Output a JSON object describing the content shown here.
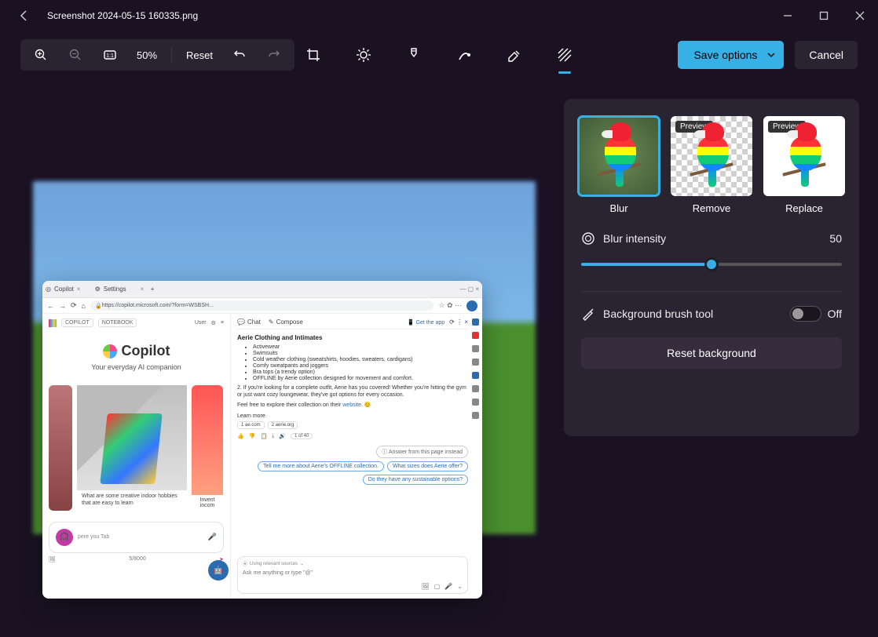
{
  "titlebar": {
    "filename": "Screenshot 2024-05-15 160335.png"
  },
  "toolbar": {
    "zoom_percent": "50%",
    "reset_label": "Reset"
  },
  "actions": {
    "save_label": "Save options",
    "cancel_label": "Cancel"
  },
  "panel": {
    "options": {
      "blur": "Blur",
      "remove": "Remove",
      "replace": "Replace",
      "preview_badge": "Preview"
    },
    "intensity": {
      "label": "Blur intensity",
      "value": "50"
    },
    "brush": {
      "label": "Background brush tool",
      "state": "Off"
    },
    "reset_bg": "Reset background"
  },
  "preview": {
    "tabs": {
      "tab1": "Copilot",
      "tab2": "Settings"
    },
    "url": "https://copilot.microsoft.com/?form=WSBSH...",
    "left": {
      "nav_copilot": "COPILOT",
      "nav_notebook": "NOTEBOOK",
      "user": "User",
      "brand": "Copilot",
      "tagline": "Your everyday AI companion",
      "card_caption": "What are some creative indoor hobbies that are easy to learn",
      "card_side2": "Invent incom",
      "input_placeholder": "pere you  Tab",
      "counter": "5/8000"
    },
    "right": {
      "tab_chat": "Chat",
      "tab_compose": "Compose",
      "get_app": "Get the app",
      "heading": "Aerie Clothing and Intimates",
      "bullets": {
        "b1": "Activewear",
        "b2": "Swimsuits",
        "b3": "Cold weather clothing (sweatshirts, hoodies, sweaters, cardigans)",
        "b4": "Comfy sweatpants and joggers",
        "b5": "Bra tops (a trendy option)",
        "b6": "OFFLINE by Aerie collection designed for movement and comfort."
      },
      "para1": "2. If you're looking for a complete outfit, Aerie has you covered! Whether you're hitting the gym or just want cozy loungewear, they've got options for every occasion.",
      "para2_a": "Feel free to explore their collection on their ",
      "para2_link": "website",
      "para2_b": ". 😊",
      "learn_more": "Learn more",
      "site1": "1  ae.com",
      "site2": "2  aerie.org",
      "action_tag": "1 of 40",
      "sugg_info": "Answer from this page instead",
      "sugg1": "Tell me more about Aerie's OFFLINE collection.",
      "sugg2": "What sizes does Aerie offer?",
      "sugg3": "Do they have any sustainable options?",
      "src": "Using relevant sources",
      "ask": "Ask me anything or type \"@\""
    }
  }
}
